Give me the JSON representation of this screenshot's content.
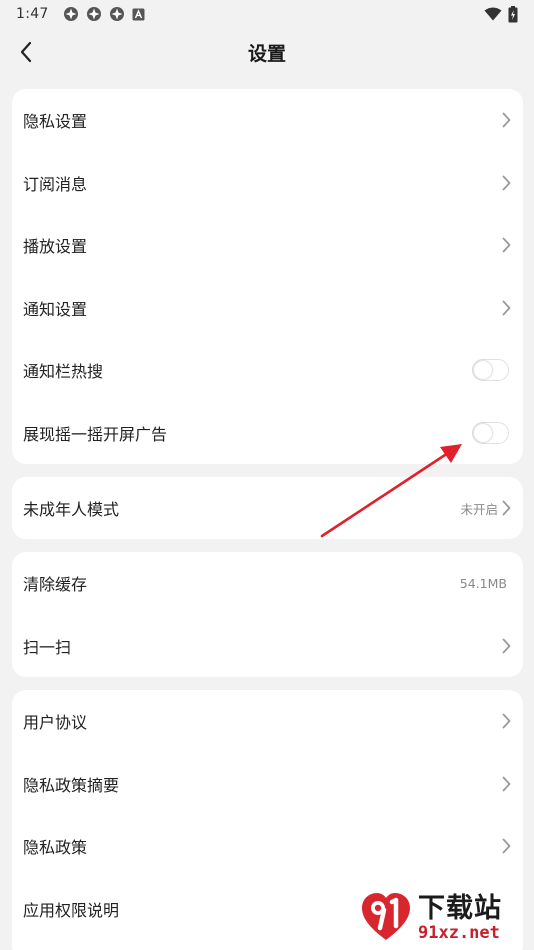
{
  "status_bar": {
    "time": "1:47",
    "left_icons": [
      "app-notification-icon",
      "app-notification-icon",
      "app-notification-icon",
      "text-a-icon"
    ],
    "right_icons": [
      "wifi-icon",
      "battery-charging-icon"
    ]
  },
  "header": {
    "title": "设置",
    "back_icon": "back-arrow-icon"
  },
  "group1": {
    "items": [
      {
        "label": "隐私设置"
      },
      {
        "label": "订阅消息"
      },
      {
        "label": "播放设置"
      },
      {
        "label": "通知设置"
      },
      {
        "label": "通知栏热搜",
        "toggle": "off"
      },
      {
        "label": "展现摇一摇开屏广告",
        "toggle": "off"
      }
    ]
  },
  "group2": {
    "items": [
      {
        "label": "未成年人模式",
        "value": "未开启"
      }
    ]
  },
  "group3": {
    "items": [
      {
        "label": "清除缓存",
        "value": "54.1MB"
      },
      {
        "label": "扫一扫"
      }
    ]
  },
  "group4": {
    "items": [
      {
        "label": "用户协议"
      },
      {
        "label": "隐私政策摘要"
      },
      {
        "label": "隐私政策"
      },
      {
        "label": "应用权限说明"
      }
    ]
  },
  "annotation": {
    "color": "#e0202a"
  },
  "watermark": {
    "title": "下载站",
    "url": "91xz.net",
    "logo_icon": "91-logo-icon",
    "accent_color": "#c8202a"
  },
  "colors": {
    "background": "#f2f2f2",
    "card": "#ffffff",
    "text": "#222222",
    "secondary_text": "#8a8a8a",
    "chevron": "#9a9a9a"
  }
}
